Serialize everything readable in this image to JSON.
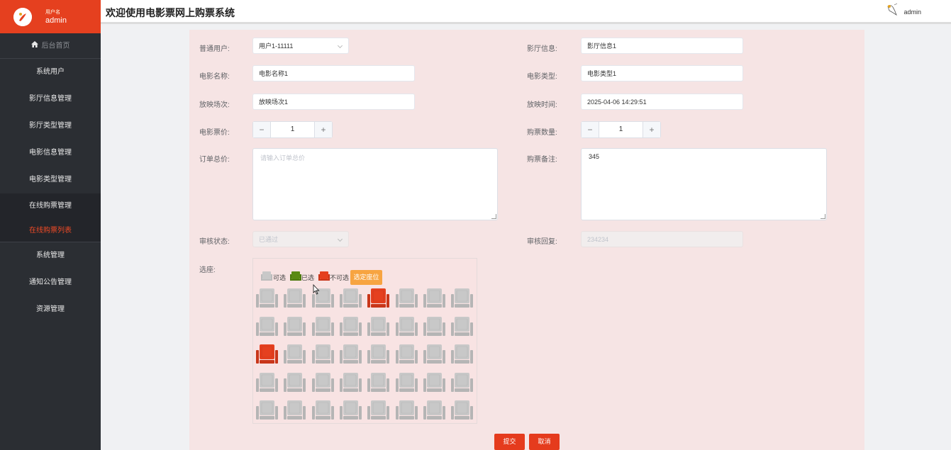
{
  "sidebar": {
    "user_label": "用户名",
    "user_name": "admin",
    "home": "后台首页",
    "items": [
      {
        "label": "系统用户"
      },
      {
        "label": "影厅信息管理"
      },
      {
        "label": "影厅类型管理"
      },
      {
        "label": "电影信息管理"
      },
      {
        "label": "电影类型管理"
      },
      {
        "label": "在线购票管理"
      }
    ],
    "sub_active": "在线购票列表",
    "items2": [
      {
        "label": "系统管理"
      },
      {
        "label": "通知公告管理"
      },
      {
        "label": "资源管理"
      }
    ]
  },
  "header": {
    "title": "欢迎使用电影票网上购票系统",
    "user": "admin"
  },
  "form": {
    "user_label": "普通用户:",
    "user_value": "用户1-11111",
    "hall_label": "影厅信息:",
    "hall_value": "影厅信息1",
    "movie_name_label": "电影名称:",
    "movie_name_value": "电影名称1",
    "movie_type_label": "电影类型:",
    "movie_type_value": "电影类型1",
    "session_label": "放映场次:",
    "session_value": "放映场次1",
    "time_label": "放映时间:",
    "time_value": "2025-04-06 14:29:51",
    "price_label": "电影票价:",
    "price_value": "1",
    "qty_label": "购票数量:",
    "qty_value": "1",
    "total_label": "订单总价:",
    "total_placeholder": "请输入订单总价",
    "remark_label": "购票备注:",
    "remark_value": "345",
    "status_label": "审核状态:",
    "status_value": "已通过",
    "reply_label": "审核回复:",
    "reply_value": "234234",
    "seat_label": "选座:",
    "legend_available": "可选",
    "legend_selected": "已选",
    "legend_unavailable": "不可选",
    "pick_button": "选定座位",
    "submit": "提交",
    "cancel": "取消"
  },
  "seats": {
    "rows": 5,
    "cols": 8,
    "unavailable": [
      [
        0,
        4
      ],
      [
        2,
        0
      ]
    ],
    "colors": {
      "available": "#c8c8c8",
      "selected": "#5a8a12",
      "unavailable": "#e5401f"
    }
  },
  "colors": {
    "brand": "#e5401f",
    "sidebar": "#2b2e33",
    "panel": "#f6e4e4"
  }
}
